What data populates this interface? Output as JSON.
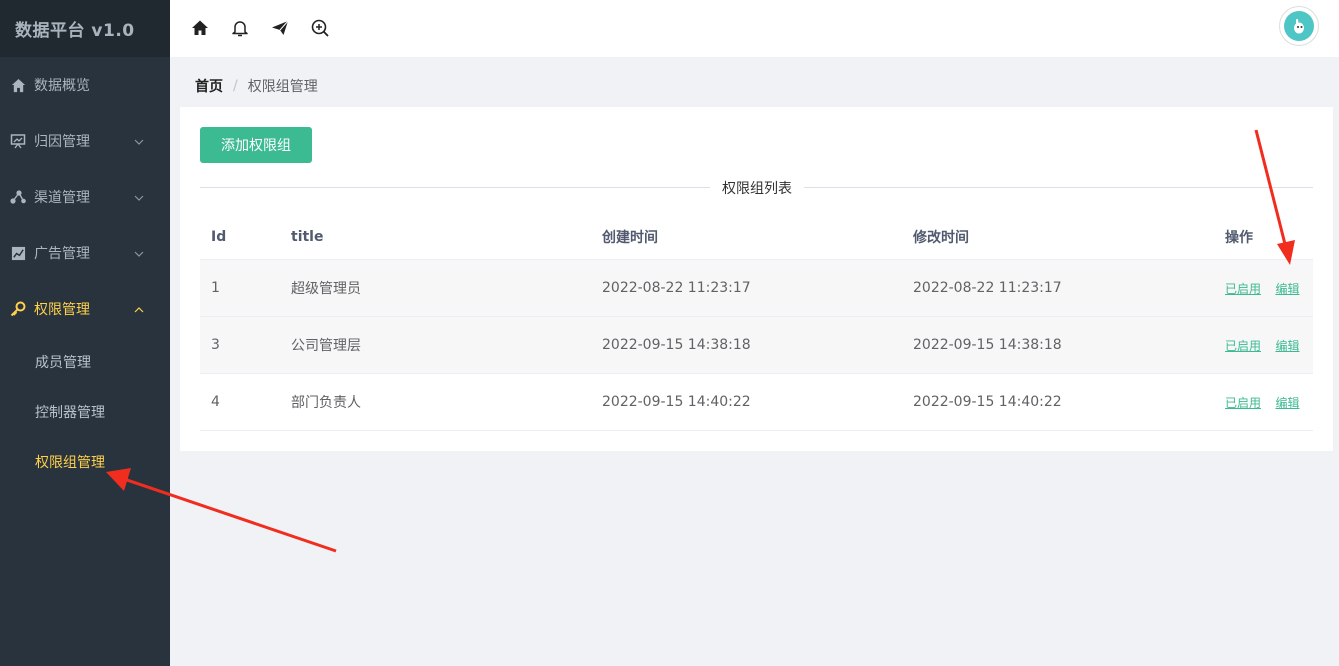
{
  "app": {
    "title": "数据平台 v1.0"
  },
  "sidebar": {
    "items": [
      {
        "label": "数据概览",
        "icon": "home-icon"
      },
      {
        "label": "归因管理",
        "icon": "presentation-icon"
      },
      {
        "label": "渠道管理",
        "icon": "share-icon"
      },
      {
        "label": "广告管理",
        "icon": "chart-icon"
      },
      {
        "label": "权限管理",
        "icon": "key-icon"
      }
    ],
    "subitems": [
      {
        "label": "成员管理"
      },
      {
        "label": "控制器管理"
      },
      {
        "label": "权限组管理"
      }
    ]
  },
  "header": {
    "icons": [
      "home-icon",
      "bell-icon",
      "send-icon",
      "zoom-in-icon"
    ]
  },
  "breadcrumb": {
    "home": "首页",
    "separator": "/",
    "current": "权限组管理"
  },
  "toolbar": {
    "add_label": "添加权限组"
  },
  "section": {
    "title": "权限组列表"
  },
  "table": {
    "headers": [
      "Id",
      "title",
      "创建时间",
      "修改时间",
      "操作"
    ],
    "rows": [
      {
        "id": "1",
        "title": "超级管理员",
        "created": "2022-08-22 11:23:17",
        "modified": "2022-08-22 11:23:17",
        "status": "已启用",
        "edit": "编辑"
      },
      {
        "id": "3",
        "title": "公司管理层",
        "created": "2022-09-15 14:38:18",
        "modified": "2022-09-15 14:38:18",
        "status": "已启用",
        "edit": "编辑"
      },
      {
        "id": "4",
        "title": "部门负责人",
        "created": "2022-09-15 14:40:22",
        "modified": "2022-09-15 14:40:22",
        "status": "已启用",
        "edit": "编辑"
      }
    ]
  },
  "colors": {
    "sidebar_bg": "#28333e",
    "accent": "#3cba92",
    "active": "#ffd04b",
    "annotation": "#f02d1e"
  }
}
